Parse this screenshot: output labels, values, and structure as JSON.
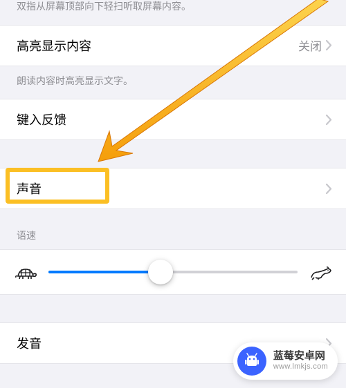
{
  "descriptions": {
    "top_hint": "双指从屏幕顶部向下轻扫听取屏幕内容。",
    "highlight_hint": "朗读内容时高亮显示文字。"
  },
  "items": {
    "highlight": {
      "label": "高亮显示内容",
      "value": "关闭"
    },
    "typing_feedback": {
      "label": "键入反馈"
    },
    "voice": {
      "label": "声音"
    },
    "pronunciation": {
      "label": "发音"
    }
  },
  "sections": {
    "speed_label": "语速"
  },
  "slider": {
    "percent": 45
  },
  "watermark": {
    "title": "蓝莓安卓网",
    "url": "www.lmkjs.com"
  }
}
